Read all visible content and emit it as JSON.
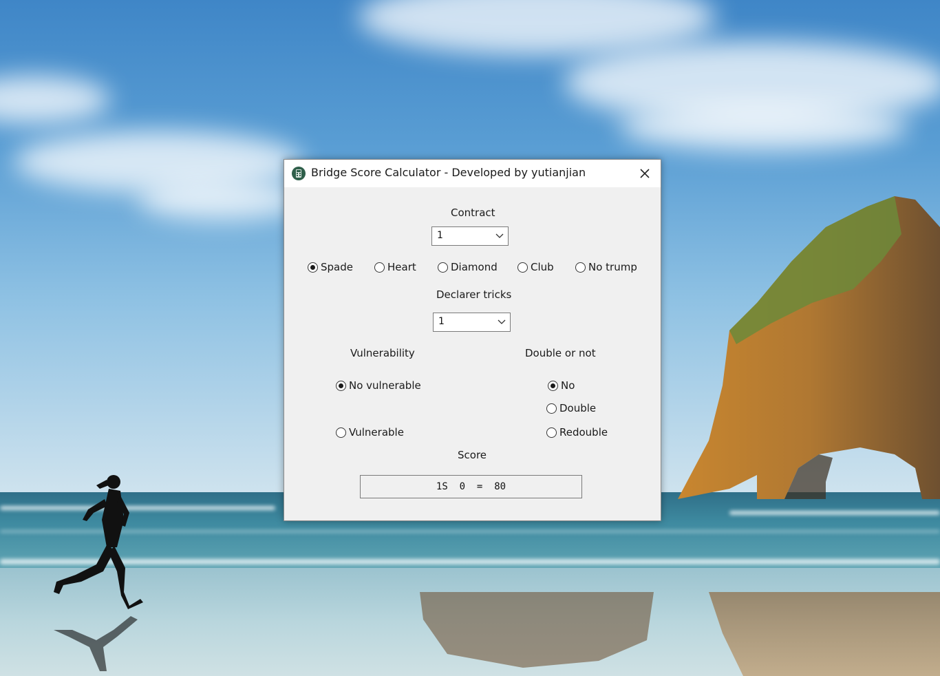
{
  "window": {
    "title": "Bridge Score Calculator - Developed by yutianjian",
    "icon": "calculator-icon",
    "close_icon": "close-icon"
  },
  "contract": {
    "label": "Contract",
    "level_value": "1",
    "suits": [
      {
        "label": "Spade",
        "selected": true
      },
      {
        "label": "Heart",
        "selected": false
      },
      {
        "label": "Diamond",
        "selected": false
      },
      {
        "label": "Club",
        "selected": false
      },
      {
        "label": "No trump",
        "selected": false
      }
    ]
  },
  "declarer": {
    "label": "Declarer tricks",
    "value": "1"
  },
  "vulnerability": {
    "label": "Vulnerability",
    "options": [
      {
        "label": "No vulnerable",
        "selected": true
      },
      {
        "label": "Vulnerable",
        "selected": false
      }
    ]
  },
  "double": {
    "label": "Double or not",
    "options": [
      {
        "label": "No",
        "selected": true
      },
      {
        "label": "Double",
        "selected": false
      },
      {
        "label": "Redouble",
        "selected": false
      }
    ]
  },
  "score": {
    "label": "Score",
    "value": "1S  0  =  80"
  },
  "colors": {
    "window_bg": "#f0f0f0",
    "titlebar_bg": "#ffffff",
    "accent": "#1a1a1a"
  }
}
